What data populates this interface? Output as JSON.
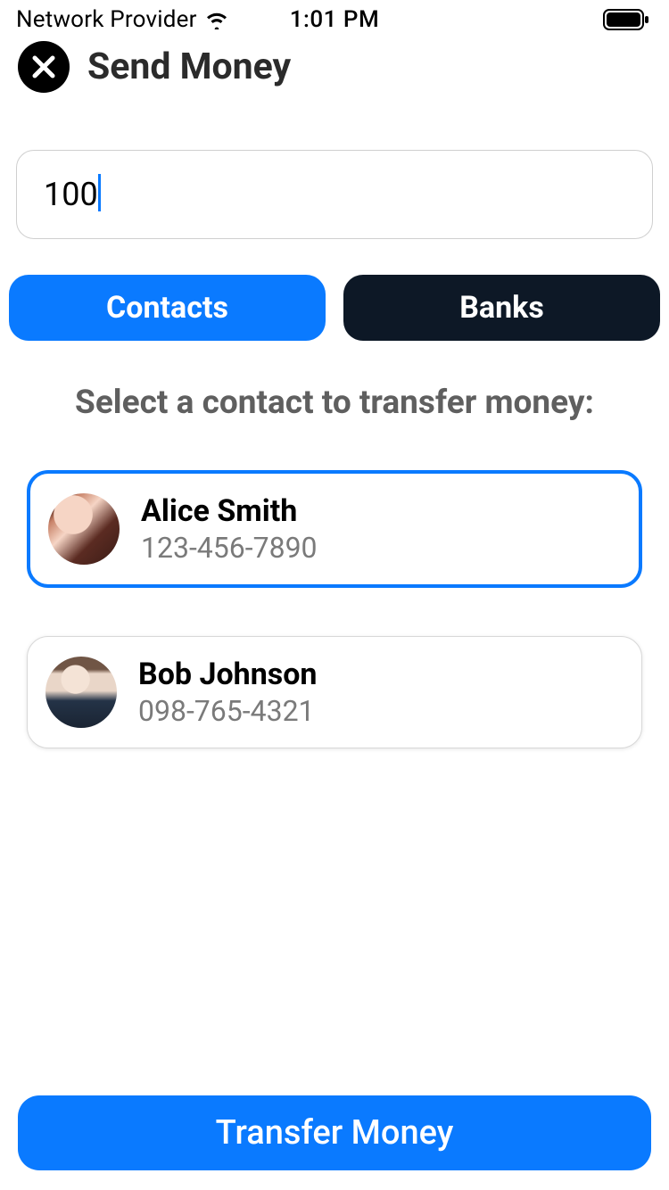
{
  "status_bar": {
    "carrier": "Network Provider",
    "time": "1:01 PM"
  },
  "header": {
    "title": "Send Money"
  },
  "amount": {
    "value": "100"
  },
  "tabs": {
    "contacts": "Contacts",
    "banks": "Banks",
    "active": "contacts"
  },
  "instruction": "Select a contact to transfer money:",
  "contacts": [
    {
      "name": "Alice Smith",
      "phone": "123-456-7890",
      "selected": true
    },
    {
      "name": "Bob Johnson",
      "phone": "098-765-4321",
      "selected": false
    }
  ],
  "transfer_button": "Transfer Money",
  "colors": {
    "accent": "#0a7aff",
    "dark_tab": "#0d1826"
  }
}
